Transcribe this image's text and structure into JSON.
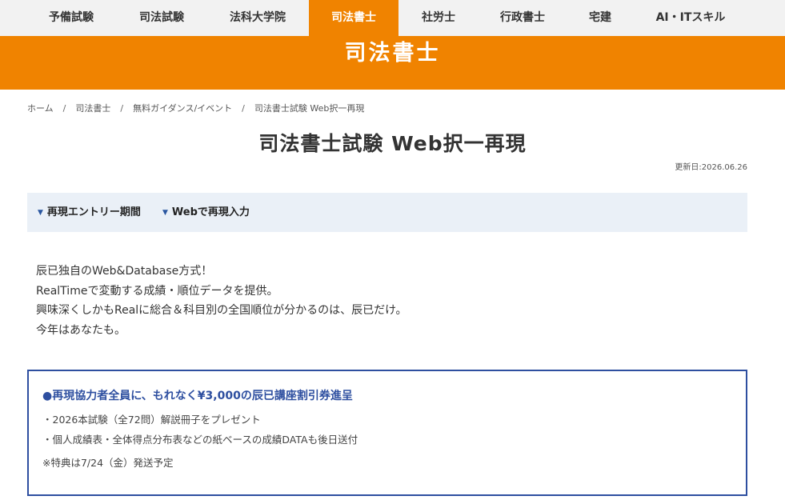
{
  "nav": {
    "items": [
      {
        "label": "予備試験",
        "active": false
      },
      {
        "label": "司法試験",
        "active": false
      },
      {
        "label": "法科大学院",
        "active": false
      },
      {
        "label": "司法書士",
        "active": true
      },
      {
        "label": "社労士",
        "active": false
      },
      {
        "label": "行政書士",
        "active": false
      },
      {
        "label": "宅建",
        "active": false
      },
      {
        "label": "AI・ITスキル",
        "active": false
      }
    ]
  },
  "banner": {
    "title": "司法書士"
  },
  "breadcrumb": {
    "items": [
      "ホーム",
      "司法書士",
      "無料ガイダンス/イベント"
    ],
    "separator": "/",
    "current": "司法書士試験 Web択一再現"
  },
  "page": {
    "title": "司法書士試験 Web択一再現",
    "updated": "更新日:2026.06.26"
  },
  "anchors": {
    "items": [
      {
        "label": "再現エントリー期間",
        "icon": "triangle-down-icon"
      },
      {
        "label": "Webで再現入力",
        "icon": "triangle-down-icon"
      }
    ]
  },
  "intro": {
    "lines": [
      "辰已独自のWeb&Database方式！",
      "RealTimeで変動する成績・順位データを提供。",
      "興味深くしかもRealに総合＆科目別の全国順位が分かるのは、辰已だけ。",
      "今年はあなたも。"
    ]
  },
  "benefit": {
    "headline": "●再現協力者全員に、もれなく¥3,000の辰已講座割引券進呈",
    "items": [
      "・2026本試験（全72問）解説冊子をプレゼント",
      "・個人成績表・全体得点分布表などの紙ベースの成績DATAも後日送付"
    ],
    "note": "※特典は7/24（金）発送予定"
  },
  "colors": {
    "brand_orange": "#f08300",
    "nav_bg": "#f2f2f2",
    "accent_blue": "#2e4fa0",
    "anchor_bar_bg": "#eaf0f7"
  }
}
